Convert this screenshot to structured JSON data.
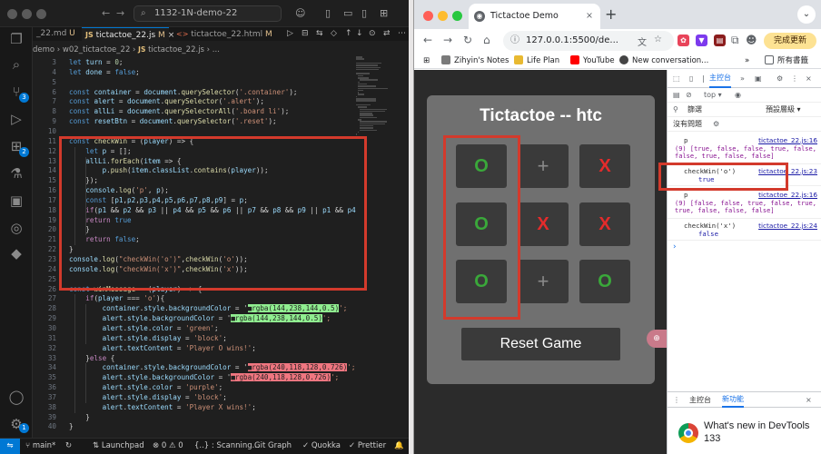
{
  "vscode": {
    "search_text": "1132-1N-demo-22",
    "tabs": [
      {
        "name": "_22.md",
        "status": "U"
      },
      {
        "name": "tictactoe_22.js",
        "status": "M",
        "type": "JS"
      },
      {
        "name": "tictactoe_22.html",
        "status": "M",
        "type": "<>"
      }
    ],
    "breadcrumbs": [
      "demo",
      "w02_tictactoe_22",
      "JS",
      "tictactoe_22.js",
      "..."
    ],
    "badges": {
      "source_control": "3",
      "extensions": "2",
      "settings": "1"
    },
    "code_lines": [
      {
        "n": "3",
        "t": "let turn = 0;"
      },
      {
        "n": "4",
        "t": "let done = false;"
      },
      {
        "n": "5",
        "t": ""
      },
      {
        "n": "6",
        "t": "const container = document.querySelector('.container');"
      },
      {
        "n": "7",
        "t": "const alert = document.querySelector('.alert');"
      },
      {
        "n": "8",
        "t": "const allLi = document.querySelectorAll('.board li');"
      },
      {
        "n": "9",
        "t": "const resetBtn = document.querySelector('.reset');"
      },
      {
        "n": "10",
        "t": ""
      },
      {
        "n": "11",
        "t": "const checkWin = (player) => {"
      },
      {
        "n": "12",
        "t": "    let p = [];"
      },
      {
        "n": "13",
        "t": "    allLi.forEach(item => {"
      },
      {
        "n": "14",
        "t": "        p.push(item.classList.contains(player));"
      },
      {
        "n": "15",
        "t": "    });"
      },
      {
        "n": "16",
        "t": "    console.log('p', p);"
      },
      {
        "n": "17",
        "t": "    const [p1,p2,p3,p4,p5,p6,p7,p8,p9] = p;"
      },
      {
        "n": "18",
        "t": "    if(p1 && p2 && p3 || p4 && p5 && p6 || p7 && p8 && p9 || p1 && p4"
      },
      {
        "n": "19",
        "t": "    return true"
      },
      {
        "n": "20",
        "t": "    }"
      },
      {
        "n": "21",
        "t": "    return false;"
      },
      {
        "n": "22",
        "t": "}"
      },
      {
        "n": "23",
        "t": "console.log(\"checkWin('o')\",checkWin('o'));"
      },
      {
        "n": "24",
        "t": "console.log(\"checkWin('x')\",checkWin('x'));"
      },
      {
        "n": "25",
        "t": ""
      },
      {
        "n": "26",
        "t": "const winMessage = (player) => {"
      },
      {
        "n": "27",
        "t": "    if(player === 'o'){"
      },
      {
        "n": "28",
        "t": "        container.style.backgroundColor = '",
        "swatch": "rgba(144,238,144,0.5)",
        "tail": "';",
        "swatch_type": "g"
      },
      {
        "n": "29",
        "t": "        alert.style.backgroundColor = '",
        "swatch": "rgba(144,238,144,0.5)",
        "tail": "';",
        "swatch_type": "g"
      },
      {
        "n": "30",
        "t": "        alert.style.color = 'green';"
      },
      {
        "n": "31",
        "t": "        alert.style.display = 'block';"
      },
      {
        "n": "32",
        "t": "        alert.textContent = 'Player O wins!';"
      },
      {
        "n": "33",
        "t": "    }else {"
      },
      {
        "n": "34",
        "t": "        container.style.backgroundColor = '",
        "swatch": "rgba(240,118,128,0.726)",
        "tail": "';",
        "swatch_type": "r"
      },
      {
        "n": "35",
        "t": "        alert.style.backgroundColor = '",
        "swatch": "rgba(240,118,128,0.726)",
        "tail": "';",
        "swatch_type": "r"
      },
      {
        "n": "36",
        "t": "        alert.style.color = 'purple';"
      },
      {
        "n": "37",
        "t": "        alert.style.display = 'block';"
      },
      {
        "n": "38",
        "t": "        alert.textContent = 'Player X wins!';"
      },
      {
        "n": "39",
        "t": "    }"
      },
      {
        "n": "40",
        "t": "}"
      }
    ],
    "status": {
      "branch": "main*",
      "launchpad": "Launchpad",
      "problems": "0",
      "warnings": "0",
      "scanning": "{..} : Scanning...",
      "git_graph": "Git Graph",
      "quokka": "Quokka",
      "prettier": "Prettier"
    }
  },
  "chrome": {
    "tab_title": "Tictactoe Demo",
    "url": "127.0.0.1:5500/de...",
    "update_button": "完成更新",
    "bookmarks": [
      "Zihyin's Notes",
      "Life Plan",
      "YouTube",
      "New conversation..."
    ],
    "all_bookmarks": "所有書籤",
    "colors": {
      "card": "#707070",
      "cell": "#3a3a3a",
      "o": "#3aa83a",
      "x": "#e32b2b",
      "highlight": "#d33a2c"
    },
    "game": {
      "title": "Tictactoe -- htc",
      "cells": [
        "O",
        "+",
        "X",
        "O",
        "X",
        "X",
        "O",
        "+",
        "O"
      ],
      "reset_label": "Reset Game"
    }
  },
  "devtools": {
    "tab_console": "主控台",
    "top_context": "top",
    "filter_label": "篩選",
    "default_levels": "預設層級",
    "no_issues": "沒有問題",
    "logs": [
      {
        "label": "p",
        "src": "tictactoe_22.js:16",
        "body": "(9) [true, false, false, true, false, false, true, false, false]"
      },
      {
        "label": "checkWin('o')",
        "src": "tictactoe_22.js:23",
        "body": "true"
      },
      {
        "label": "p",
        "src": "tictactoe_22.js:16",
        "body": "(9) [false, false, true, false, true, true, false, false, false]"
      },
      {
        "label": "checkWin('x')",
        "src": "tictactoe_22.js:24",
        "body": "false"
      }
    ],
    "drawer_tabs": [
      "主控台",
      "新功能"
    ],
    "whats_new": "What's new in DevTools 133"
  }
}
